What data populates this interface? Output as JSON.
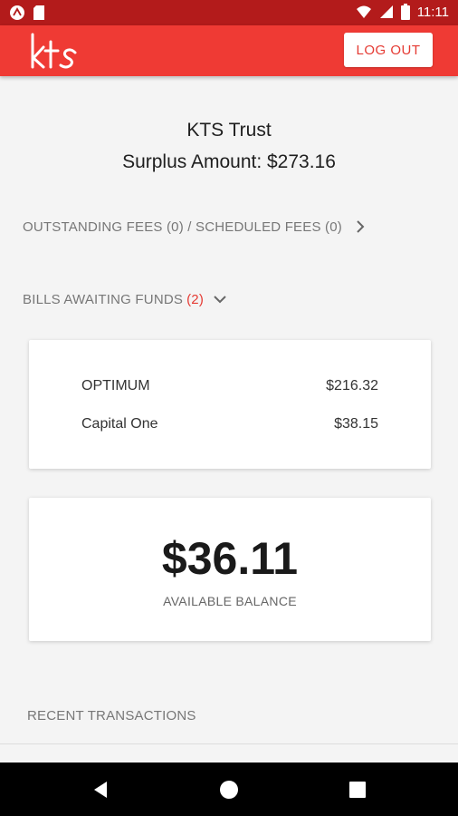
{
  "status_bar": {
    "time": "11:11"
  },
  "app_bar": {
    "logo_text": "kts",
    "logout_label": "LOG OUT"
  },
  "header": {
    "trust_name": "KTS Trust",
    "surplus": "Surplus Amount: $273.16"
  },
  "fees": {
    "label": "OUTSTANDING FEES (0) / SCHEDULED FEES (0)"
  },
  "bills": {
    "label": "BILLS AWAITING FUNDS",
    "count": "(2)",
    "items": [
      {
        "name": "OPTIMUM",
        "amount": "$216.32"
      },
      {
        "name": "Capital One",
        "amount": "$38.15"
      }
    ]
  },
  "balance": {
    "amount": "$36.11",
    "label": "AVAILABLE BALANCE"
  },
  "recent": {
    "label": "RECENT TRANSACTIONS"
  },
  "colors": {
    "brand": "#ef3a34",
    "status_bar": "#b31b1b",
    "accent_red": "#e53a33"
  }
}
